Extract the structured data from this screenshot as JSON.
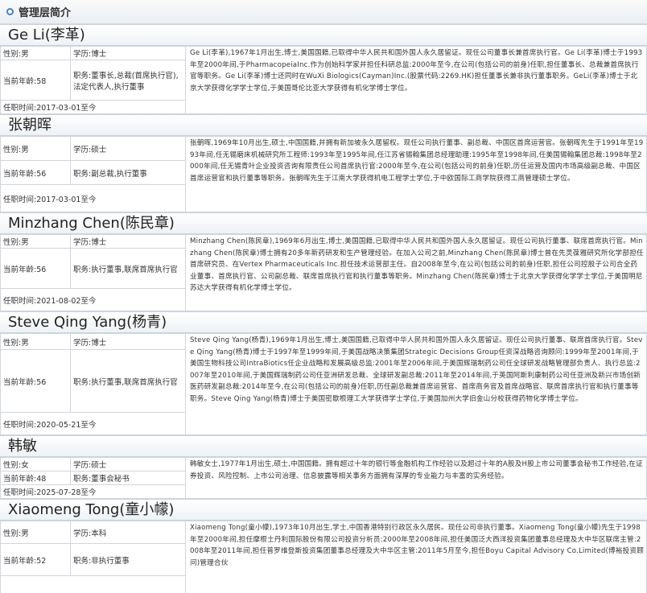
{
  "header": {
    "title": "管理层简介"
  },
  "people": [
    {
      "name": "Ge Li(李革)",
      "gender": "性别:男",
      "education": "学历:博士",
      "age": "当前年龄:58",
      "position": "职务:董事长,总裁(首席执行官),法定代表人,执行董事",
      "tenure": "任职时间:2017-03-01至今",
      "bio": "Ge Li(李革),1967年1月出生,博士,美国国籍,已取得中华人民共和国外国人永久居留证。现任公司董事长兼首席执行官。Ge Li(李革)博士于1993年至2000年间,于PharmacopeiaInc.作为创始科学家并担任科研总监:2000年至今,在公司(包括公司的前身)任职,担任董事长、总裁兼首席执行官等职务。Ge Li(李革)博士还同时在WuXi Biologics(Cayman)Inc.(股票代码:2269.HK)担任董事长兼非执行董事职务。GeLi(李革)博士于北京大学获得化学学士学位,于美国哥伦比亚大学获得有机化学博士学位。"
    },
    {
      "name": "张朝晖",
      "gender": "性别:男",
      "education": "学历:硕士",
      "age": "当前年龄:56",
      "position": "职务:副总裁,执行董事",
      "tenure": "任职时间:2017-03-01至今",
      "bio": "张朝晖,1969年10月出生,硕士,中国国籍,并拥有新加坡永久居留权。现任公司执行董事、副总裁、中国区首席运营官。张朝晖先生于1991年至1993年间,任无锡磨床机械研究所工程师:1993年至1995年间,任江苏省锡翰集团总经理助理:1995年至1998年间,任美国锡翰集团总裁:1998年至2000年间,任无锡青叶企业投资咨询有限责任公司首席执行官:2000年至今,在公司(包括公司的前身)任职,历任运营及国内市场高级副总裁、中国区首席运营官和执行董事等职务。张朝晖先生于江南大学获得机电工程学士学位,于中欧国际工商学院获得工商管理硕士学位。"
    },
    {
      "name": "Minzhang Chen(陈民章)",
      "gender": "性别:男",
      "education": "学历:博士",
      "age": "当前年龄:56",
      "position": "职务:执行董事,联席首席执行官",
      "tenure": "任职时间:2021-08-02至今",
      "bio": "Minzhang Chen(陈民章),1969年6月出生,博士,美国国籍,已取得中华人民共和国外国人永久居留证。现任公司执行董事、联席首席执行官。Minzhang Chen(陈民章)博士拥有20多年新药研发和生产管理经验。在加入公司之前,Minzhang Chen(陈民章)博士曾在先灵葆雅研究所化学部担任首席研究员、在Vertex Pharmaceuticals Inc.担任技术运营部主任。自2008年至今,在公司(包括公司的前身)任职,担任公司控股子公司合全药业董事、首席执行官、公司副总裁、联席首席执行官和执行董事等职务。Minzhang Chen(陈民章)博士于北京大学获得化学学士学位,于美国明尼苏达大学获得有机化学博士学位。"
    },
    {
      "name": "Steve Qing Yang(杨青)",
      "gender": "性别:男",
      "education": "学历:博士",
      "age": "当前年龄:56",
      "position": "职务:执行董事,联席首席执行官",
      "tenure": "任职时间:2020-05-21至今",
      "bio": "Steve Qing Yang(杨青),1969年1月出生,博士,美国国籍,已取得中华人民共和国外国人永久居留证。现任公司执行董事、联席首席执行官。Steve Qing Yang(杨青)博士于1997年至1999年间,于美国战略决策集团Strategic Decisions Group任资深战略咨询顾问:1999年至2001年间,于美国生物科技公司IntraBiotics任企业战略和发展高级总监:2001年至2006年间,于美国辉瑞制药公司任全球研发战略管理部负责人、执行总监:2007年至2010年间,于美国辉瑞制药公司任亚洲研发总裁、全球研发副总裁:2011年至2014年间,于英国阿斯利康制药公司任亚洲及新兴市场创新医药研发副总裁:2014年至今,在公司(包括公司的前身)任职,历任副总裁兼首席运营官、首席商务官及首席战略官、联席首席执行官和执行董事等职务。Steve Qing Yang(杨青)博士于美国密歇根理工大学获得学士学位,于美国加州大学旧金山分校获得药物化学博士学位。"
    },
    {
      "name": "韩敏",
      "gender": "性别:女",
      "education": "学历:硕士",
      "age": "当前年龄:48",
      "position": "职务:董事会秘书",
      "tenure": "任职时间:2025-07-28至今",
      "bio": "韩敏女士,1977年1月出生,硕士,中国国籍。拥有超过十年的银行等金融机构工作经验以及超过十年的A股及H股上市公司董事会秘书工作经验,在证券投资、风险控制、上市公司治理、信息披露等相关事务方面拥有深厚的专业能力与丰富的实务经验。"
    },
    {
      "name": "Xiaomeng Tong(童小幪)",
      "gender": "性别:男",
      "education": "学历:本科",
      "age": "当前年龄:52",
      "position": "职务:非执行董事",
      "tenure": "",
      "bio": "Xiaomeng Tong(童小幪),1973年10月出生,学士,中国香港特别行政区永久居民。现任公司非执行董事。Xiaomeng Tong(童小幪)先生于1998年至2000年间,担任摩根士丹利国际股份有限公司投资分析员:2000年至2008年间,担任美国泛大西洋投资集团董事总经理及大中华区联席主管:2008年至2011年间,担任普罗维登斯投资集团董事总经理及大中华区主管:2011年5月至今,担任Boyu Capital Advisory Co.Limited(博裕投资顾问)管理合伙"
    }
  ]
}
